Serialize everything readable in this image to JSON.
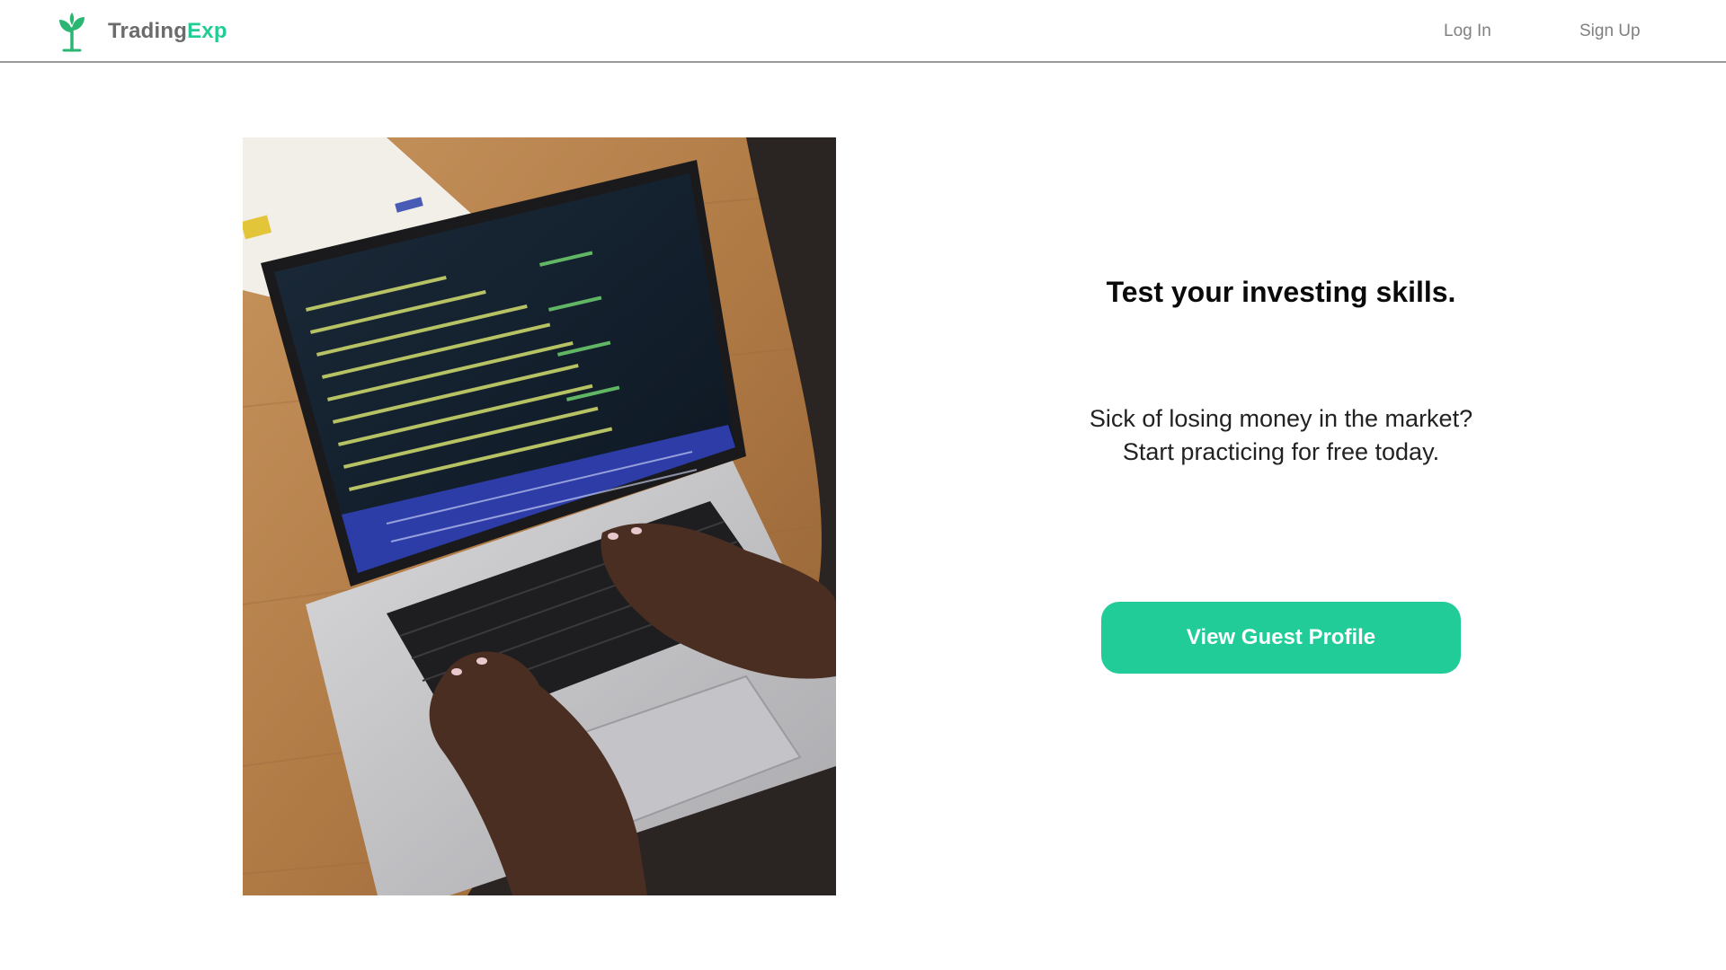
{
  "header": {
    "brand_part1": "Trading",
    "brand_part2": "Exp",
    "logo_icon": "sprout-icon",
    "login_label": "Log In",
    "signup_label": "Sign Up"
  },
  "hero": {
    "image_subject": "photo-laptop-trading-screen"
  },
  "main": {
    "headline": "Test your investing skills.",
    "subline_1": "Sick of losing money in the market?",
    "subline_2": "Start practicing for free today.",
    "cta_label": "View Guest Profile"
  },
  "colors": {
    "accent": "#22cc98",
    "brand_green": "#22cc95",
    "brand_gray": "#6b6b6b",
    "nav_text": "#808080"
  }
}
